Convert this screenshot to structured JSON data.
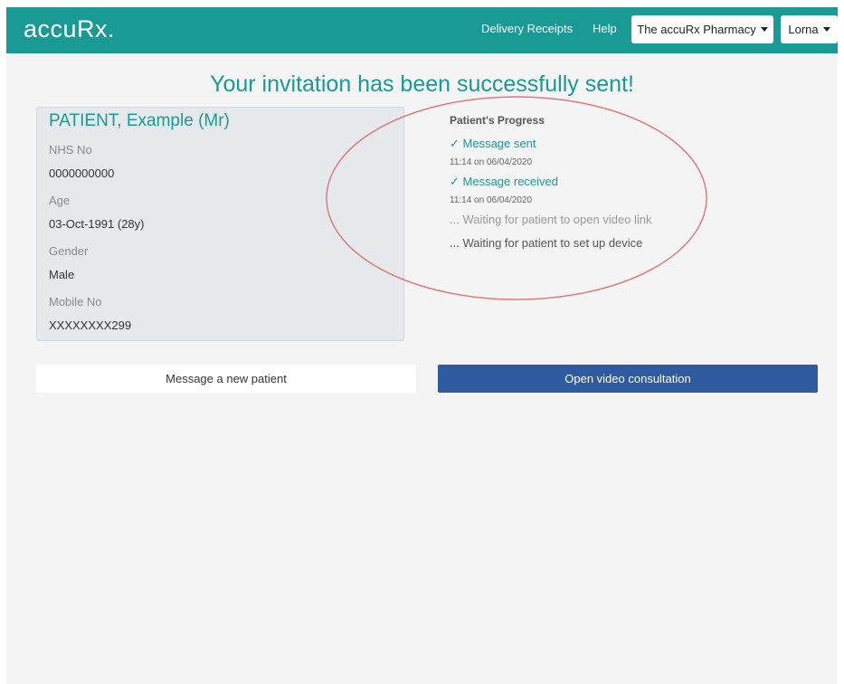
{
  "header": {
    "brand": "accuRx.",
    "links": {
      "delivery_receipts": "Delivery Receipts",
      "help": "Help"
    },
    "pharmacy_dropdown": "The accuRx Pharmacy",
    "user_dropdown": "Lorna"
  },
  "headline": "Your invitation has been successfully sent!",
  "patient": {
    "name": "PATIENT, Example (Mr)",
    "nhs_label": "NHS No",
    "nhs_value": "0000000000",
    "age_label": "Age",
    "age_value": "03-Oct-1991 (28y)",
    "gender_label": "Gender",
    "gender_value": "Male",
    "mobile_label": "Mobile No",
    "mobile_value": "XXXXXXXX299"
  },
  "progress": {
    "title": "Patient's Progress",
    "steps": [
      {
        "label": "✓ Message sent",
        "time": "11:14 on 06/04/2020"
      },
      {
        "label": "✓ Message received",
        "time": "11:14 on 06/04/2020"
      },
      {
        "label": "... Waiting for patient to open video link"
      },
      {
        "label": "... Waiting for patient to set up device"
      }
    ]
  },
  "buttons": {
    "new_patient": "Message a new patient",
    "open_video": "Open video consultation"
  },
  "colors": {
    "brand_teal": "#1a9a94",
    "primary_blue": "#2e5aa0",
    "annotation_red": "#e07a7a",
    "waiting_light": "#9a9a9a",
    "waiting_dark": "#555555"
  }
}
